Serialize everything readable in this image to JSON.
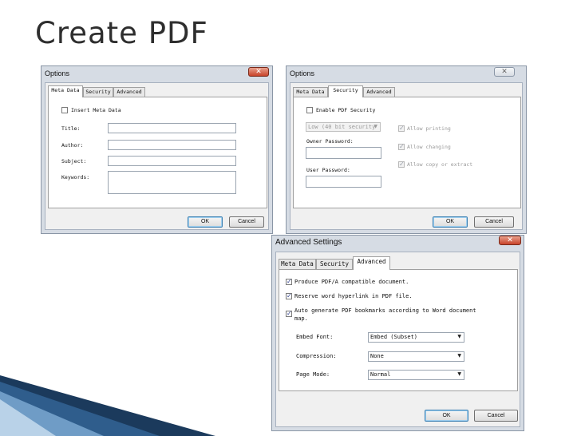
{
  "slide": {
    "title": "Create PDF"
  },
  "dialog1": {
    "title": "Options",
    "close": "✕",
    "tabs": {
      "meta": "Meta Data",
      "security": "Security",
      "advanced": "Advanced"
    },
    "insert_meta": "Insert Meta Data",
    "fields": {
      "title": "Title:",
      "author": "Author:",
      "subject": "Subject:",
      "keywords": "Keywords:"
    },
    "ok": "OK",
    "cancel": "Cancel"
  },
  "dialog2": {
    "title": "Options",
    "close": "✕",
    "tabs": {
      "meta": "Meta Data",
      "security": "Security",
      "advanced": "Advanced"
    },
    "enable_security": "Enable PDF Security",
    "encryption_value": "Low (40 bit security",
    "owner_password": "Owner Password:",
    "user_password": "User Password:",
    "allow_printing": "Allow printing",
    "allow_changing": "Allow changing",
    "allow_copy": "Allow copy or extract",
    "ok": "OK",
    "cancel": "Cancel"
  },
  "dialog3": {
    "title": "Advanced Settings",
    "close": "✕",
    "tabs": {
      "meta": "Meta Data",
      "security": "Security",
      "advanced": "Advanced"
    },
    "pdfa": "Produce PDF/A compatible document.",
    "hyperlink": "Reserve word hyperlink in PDF file.",
    "bookmarks_line1": "Auto generate PDF bookmarks according to Word document",
    "bookmarks_line2": "map.",
    "embed_font_label": "Embed Font:",
    "embed_font_value": "Embed (Subset)",
    "compression_label": "Compression:",
    "compression_value": "None",
    "page_mode_label": "Page Mode:",
    "page_mode_value": "Normal",
    "ok": "OK",
    "cancel": "Cancel"
  },
  "glyphs": {
    "check": "✓",
    "dropdown": "▼"
  }
}
